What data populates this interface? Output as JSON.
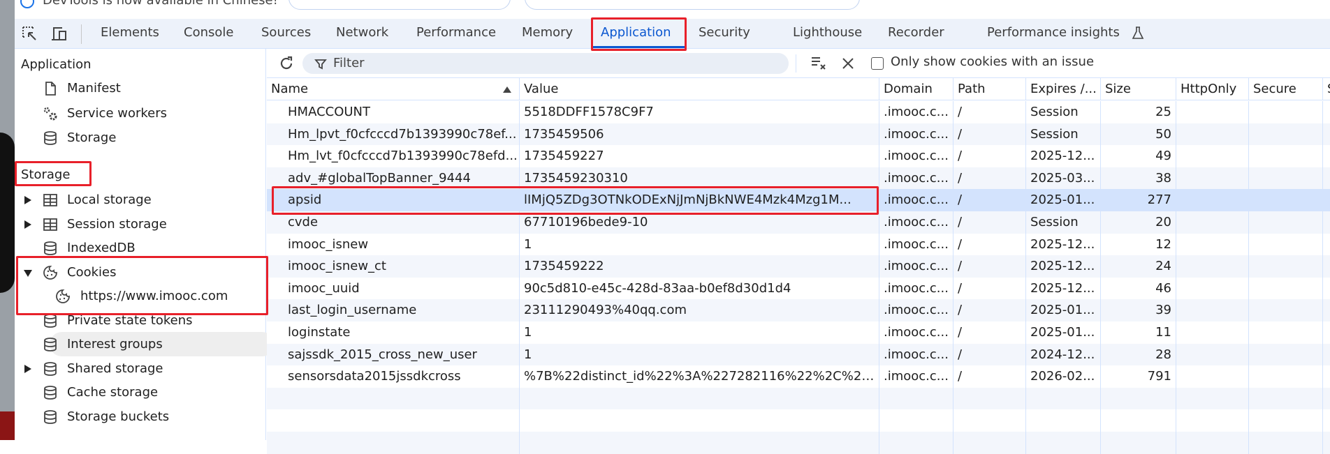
{
  "banner": {
    "text": "DevTools is now available in Chinese!"
  },
  "tabs": [
    {
      "label": "Elements"
    },
    {
      "label": "Console"
    },
    {
      "label": "Sources"
    },
    {
      "label": "Network"
    },
    {
      "label": "Performance"
    },
    {
      "label": "Memory"
    },
    {
      "label": "Application",
      "active": true
    },
    {
      "label": "Security"
    },
    {
      "label": "Lighthouse"
    },
    {
      "label": "Recorder"
    },
    {
      "label": "Performance insights"
    }
  ],
  "sidebar": {
    "application_header": "Application",
    "application_items": [
      {
        "label": "Manifest",
        "icon": "file-icon"
      },
      {
        "label": "Service workers",
        "icon": "gears-icon"
      },
      {
        "label": "Storage",
        "icon": "database-icon"
      }
    ],
    "storage_header": "Storage",
    "storage_items": [
      {
        "label": "Local storage",
        "icon": "table-icon",
        "expandable": true
      },
      {
        "label": "Session storage",
        "icon": "table-icon",
        "expandable": true
      },
      {
        "label": "IndexedDB",
        "icon": "database-icon"
      },
      {
        "label": "Cookies",
        "icon": "cookie-icon",
        "expanded": true
      },
      {
        "label": "https://www.imooc.com",
        "icon": "cookie-icon",
        "child": true,
        "selected": true
      },
      {
        "label": "Private state tokens",
        "icon": "database-icon"
      },
      {
        "label": "Interest groups",
        "icon": "database-icon"
      },
      {
        "label": "Shared storage",
        "icon": "database-icon",
        "expandable": true
      },
      {
        "label": "Cache storage",
        "icon": "database-icon"
      },
      {
        "label": "Storage buckets",
        "icon": "database-icon"
      }
    ]
  },
  "toolbar": {
    "filter_placeholder": "Filter",
    "only_issues_label": "Only show cookies with an issue",
    "only_issues_checked": false
  },
  "table": {
    "columns": [
      "Name",
      "Value",
      "Domain",
      "Path",
      "Expires /...",
      "Size",
      "HttpOnly",
      "Secure",
      "S"
    ],
    "sort": {
      "column": "Name",
      "direction": "ascending"
    },
    "selected_row": 4,
    "rows": [
      [
        "HMACCOUNT",
        "5518DDFF1578C9F7",
        ".imooc.c...",
        "/",
        "Session",
        "25"
      ],
      [
        "Hm_lpvt_f0cfcccd7b1393990c78ef...",
        "1735459506",
        ".imooc.c...",
        "/",
        "Session",
        "50"
      ],
      [
        "Hm_lvt_f0cfcccd7b1393990c78efd...",
        "1735459227",
        ".imooc.c...",
        "/",
        "2025-12...",
        "49"
      ],
      [
        "adv_#globalTopBanner_9444",
        "1735459230310",
        ".imooc.c...",
        "/",
        "2025-03...",
        "38"
      ],
      [
        "apsid",
        "lIMjQ5ZDg3OTNkODExNjJmNjBkNWE4Mzk4Mzg1M...",
        ".imooc.c...",
        "/",
        "2025-01...",
        "277"
      ],
      [
        "cvde",
        "67710196bede9-10",
        ".imooc.c...",
        "/",
        "Session",
        "20"
      ],
      [
        "imooc_isnew",
        "1",
        ".imooc.c...",
        "/",
        "2025-12...",
        "12"
      ],
      [
        "imooc_isnew_ct",
        "1735459222",
        ".imooc.c...",
        "/",
        "2025-12...",
        "24"
      ],
      [
        "imooc_uuid",
        "90c5d810-e45c-428d-83aa-b0ef8d30d1d4",
        ".imooc.c...",
        "/",
        "2025-12...",
        "46"
      ],
      [
        "last_login_username",
        "23111290493%40qq.com",
        ".imooc.c...",
        "/",
        "2025-01...",
        "39"
      ],
      [
        "loginstate",
        "1",
        ".imooc.c...",
        "/",
        "2025-01...",
        "11"
      ],
      [
        "sajssdk_2015_cross_new_user",
        "1",
        ".imooc.c...",
        "/",
        "2024-12...",
        "28"
      ],
      [
        "sensorsdata2015jssdkcross",
        "%7B%22distinct_id%22%3A%227282116%22%2C%22...",
        ".imooc.c...",
        "/",
        "2026-02...",
        "791"
      ]
    ]
  },
  "colors": {
    "accent": "#0b57d0",
    "highlight": "#e8202a",
    "selected_row": "#d3e3fd",
    "alt_row": "#f3f6fc"
  }
}
